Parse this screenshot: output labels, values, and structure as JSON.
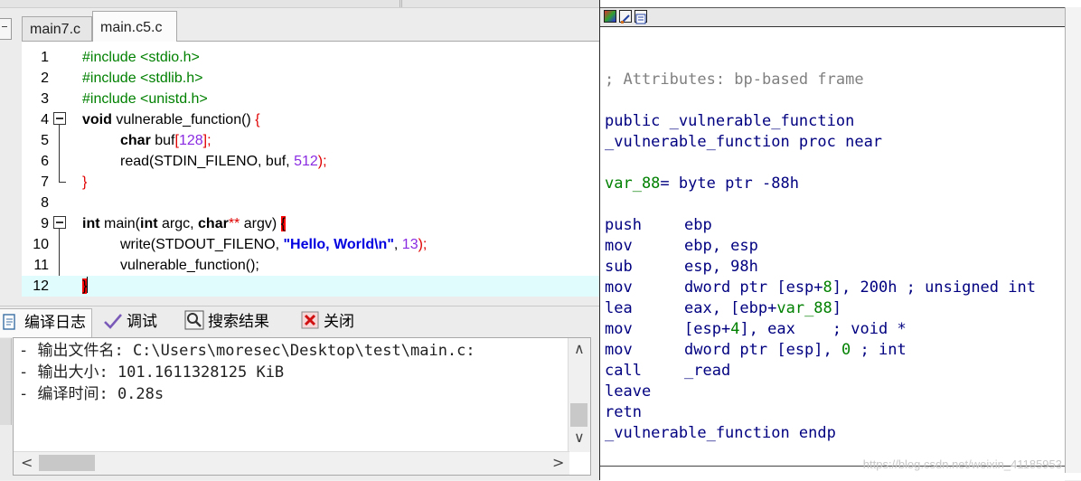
{
  "editor": {
    "tabs": [
      {
        "label": "main7.c",
        "active": false
      },
      {
        "label": "main.c5.c",
        "active": true
      }
    ],
    "line_numbers": [
      "1",
      "2",
      "3",
      "4",
      "5",
      "6",
      "7",
      "8",
      "9",
      "10",
      "11",
      "12"
    ],
    "code": {
      "l1": "#include <stdio.h>",
      "l2": "#include <stdlib.h>",
      "l3": "#include <unistd.h>",
      "l4_kw": "void",
      "l4_rest": " vulnerable_function() ",
      "l4_brace": "{",
      "l5_kw": "char",
      "l5_a": " buf",
      "l5_b": "[",
      "l5_num": "128",
      "l5_c": "];",
      "l6_a": "read(STDIN_FILENO, buf, ",
      "l6_num": "512",
      "l6_b": ");",
      "l7_brace": "}",
      "l9_kw1": "int",
      "l9_a": " main(",
      "l9_kw2": "int",
      "l9_b": " argc, ",
      "l9_kw3": "char",
      "l9_stars": "**",
      "l9_c": " argv) ",
      "l9_brace": "{",
      "l10_a": "write(STDOUT_FILENO, ",
      "l10_str": "\"Hello, World\\n\"",
      "l10_b": ", ",
      "l10_num": "13",
      "l10_c": ");",
      "l11": "vulnerable_function();",
      "l12_brace": "}"
    }
  },
  "bottom_panel": {
    "tabs": [
      {
        "label": "编译日志",
        "icon": "compile-log-icon"
      },
      {
        "label": "调试",
        "icon": "debug-check-icon"
      },
      {
        "label": "搜索结果",
        "icon": "search-results-icon"
      },
      {
        "label": "关闭",
        "icon": "close-panel-icon"
      }
    ],
    "log": [
      "- 输出文件名: C:\\Users\\moresec\\Desktop\\test\\main.c:",
      "- 输出大小: 101.1611328125 KiB",
      "- 编译时间: 0.28s"
    ]
  },
  "ida": {
    "comment": "; Attributes: bp-based frame",
    "public_line": "public _vulnerable_function",
    "proc_line": "_vulnerable_function proc near",
    "var_line": {
      "name": "var_88",
      "rest": "= byte ptr -88h"
    },
    "instructions": [
      {
        "mn": "push",
        "op": "ebp"
      },
      {
        "mn": "mov",
        "op": "ebp, esp"
      },
      {
        "mn": "sub",
        "op": "esp, 98h"
      },
      {
        "mn": "mov",
        "op_a": "dword ptr [esp+",
        "op_num": "8",
        "op_b": "], 200h ",
        "cmt": "; unsigned int"
      },
      {
        "mn": "lea",
        "op_a": "eax, [ebp+",
        "op_var": "var_88",
        "op_b": "]"
      },
      {
        "mn": "mov",
        "op_a": "[esp+",
        "op_num": "4",
        "op_b": "], eax    ",
        "cmt": "; void *"
      },
      {
        "mn": "mov",
        "op_a": "dword ptr [esp], ",
        "op_num": "0",
        "op_b": " ",
        "cmt": "; int"
      },
      {
        "mn": "call",
        "op": "_read"
      },
      {
        "mn": "leave",
        "op": ""
      },
      {
        "mn": "retn",
        "op": ""
      }
    ],
    "endp_line": "_vulnerable_function endp"
  },
  "watermark": "https://blog.csdn.net/weixin_41185953",
  "colors": {
    "preprocessor": "#008000",
    "brace": "#e00000",
    "number": "#8a2be2",
    "string": "#0000e0",
    "asm_text": "#000080",
    "asm_comment": "#808080",
    "asm_green": "#008000",
    "current_line": "#e0fcfc"
  }
}
